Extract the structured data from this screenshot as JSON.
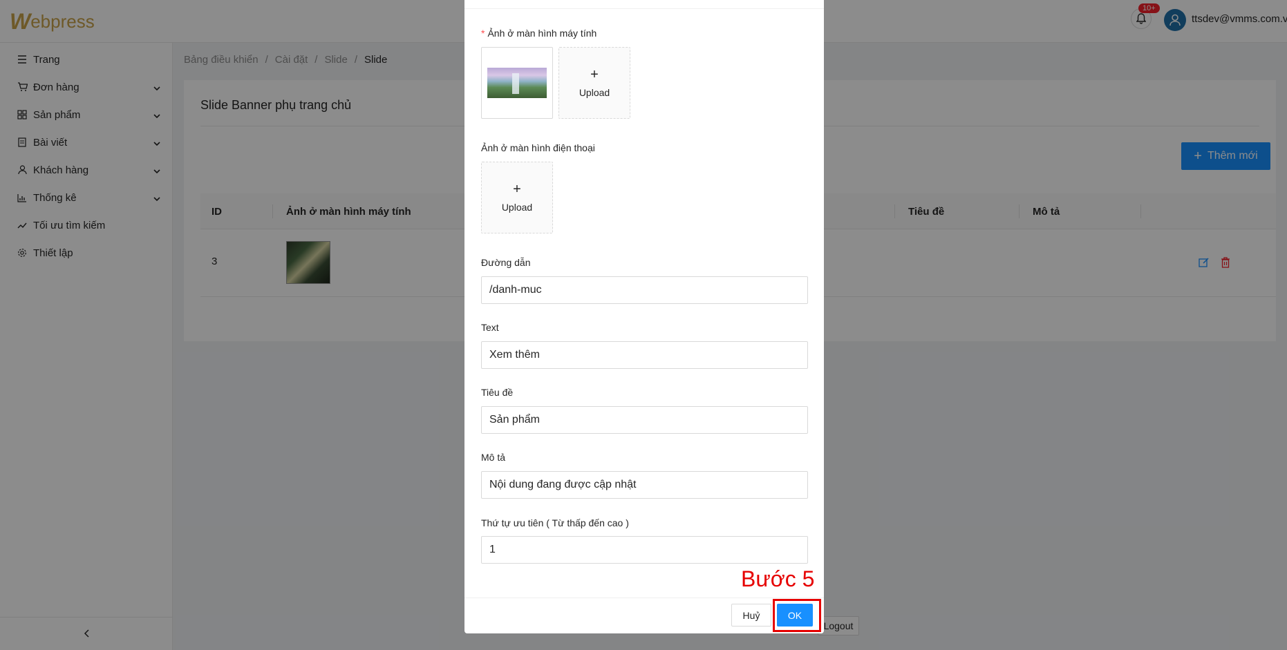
{
  "header": {
    "logo_initial": "W",
    "logo_text": "ebpress",
    "notification_badge": "10+",
    "user_email": "ttsdev@vmms.com.vn"
  },
  "sidebar": {
    "items": [
      {
        "label": "Trang",
        "icon": "list-icon",
        "has_submenu": false
      },
      {
        "label": "Đơn hàng",
        "icon": "cart-icon",
        "has_submenu": true
      },
      {
        "label": "Sản phẩm",
        "icon": "grid-icon",
        "has_submenu": true
      },
      {
        "label": "Bài viết",
        "icon": "document-icon",
        "has_submenu": true
      },
      {
        "label": "Khách hàng",
        "icon": "user-icon",
        "has_submenu": true
      },
      {
        "label": "Thống kê",
        "icon": "bar-chart-icon",
        "has_submenu": true
      },
      {
        "label": "Tối ưu tìm kiếm",
        "icon": "trend-icon",
        "has_submenu": false
      },
      {
        "label": "Thiết lập",
        "icon": "gear-icon",
        "has_submenu": false
      }
    ]
  },
  "breadcrumb": [
    "Bảng điều khiển",
    "Cài đặt",
    "Slide",
    "Slide"
  ],
  "page": {
    "title": "Slide Banner phụ trang chủ",
    "add_button": "Thêm mới",
    "table": {
      "columns": [
        "ID",
        "Ảnh ở màn hình máy tính",
        "Tiêu đề",
        "Mô tả"
      ],
      "rows": [
        {
          "id": "3"
        }
      ]
    },
    "logout": "Logout"
  },
  "modal": {
    "desktop_image_label": "Ảnh ở màn hình máy tính",
    "mobile_image_label": "Ảnh ở màn hình điện thoại",
    "upload_label": "Upload",
    "fields": {
      "path": {
        "label": "Đường dẫn",
        "value": "/danh-muc"
      },
      "text": {
        "label": "Text",
        "value": "Xem thêm"
      },
      "title": {
        "label": "Tiêu đề",
        "value": "Sản phẩm"
      },
      "description": {
        "label": "Mô tả",
        "value": "Nội dung đang được cập nhật"
      },
      "priority": {
        "label": "Thứ tự ưu tiên ( Từ thấp đến cao )",
        "value": "1"
      }
    },
    "cancel": "Huỷ",
    "ok": "OK"
  },
  "annotation": {
    "step_label": "Bước 5",
    "color": "#e60000"
  },
  "colors": {
    "primary": "#1890ff",
    "brand": "#c8a24a",
    "danger": "#f5222d"
  }
}
